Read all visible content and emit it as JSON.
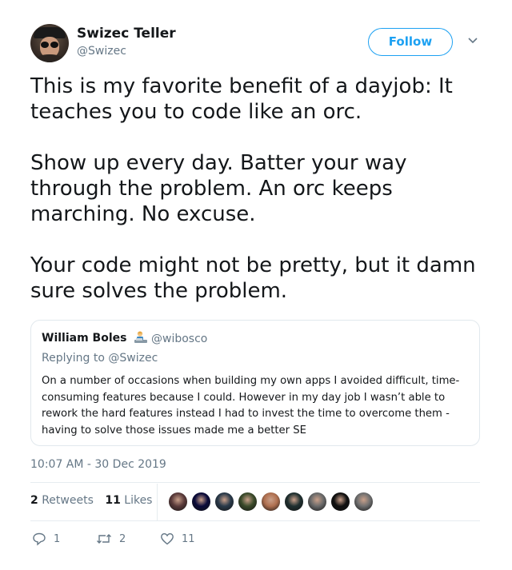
{
  "author": {
    "name": "Swizec Teller",
    "handle": "@Swizec",
    "follow_label": "Follow"
  },
  "tweet": {
    "paragraphs": [
      "This is my favorite benefit of a dayjob: It teaches you to code like an orc.",
      "Show up every day. Batter your way through the problem. An orc keeps marching. No excuse.",
      "Your code might not be pretty, but it damn sure solves the problem."
    ]
  },
  "quote": {
    "name": "William Boles",
    "emoji_icon": "person-at-laptop-emoji",
    "handle": "@wibosco",
    "reply_prefix": "Replying to",
    "reply_to": "@Swizec",
    "text": "On a number of occasions when building my own apps I avoided difficult, time-consuming features because I could. However in my day job I wasn’t able to rework the hard features instead I had to invest the time to overcome them - having to solve those issues made me a better SE"
  },
  "timestamp": "10:07 AM - 30 Dec 2019",
  "stats": {
    "retweets_count": "2",
    "retweets_label": "Retweets",
    "likes_count": "11",
    "likes_label": "Likes"
  },
  "likers_avatar_colors": [
    "#5a3a3a",
    "#0a0a3a",
    "#2a3a4a",
    "#3a4a2a",
    "#b07050",
    "#203030",
    "#6a6a6a",
    "#101010",
    "#707070"
  ],
  "actions": {
    "reply_count": "1",
    "retweet_count": "2",
    "like_count": "11"
  },
  "colors": {
    "accent": "#1da1f2",
    "secondary_text": "#657786",
    "border": "#e1e8ed"
  }
}
